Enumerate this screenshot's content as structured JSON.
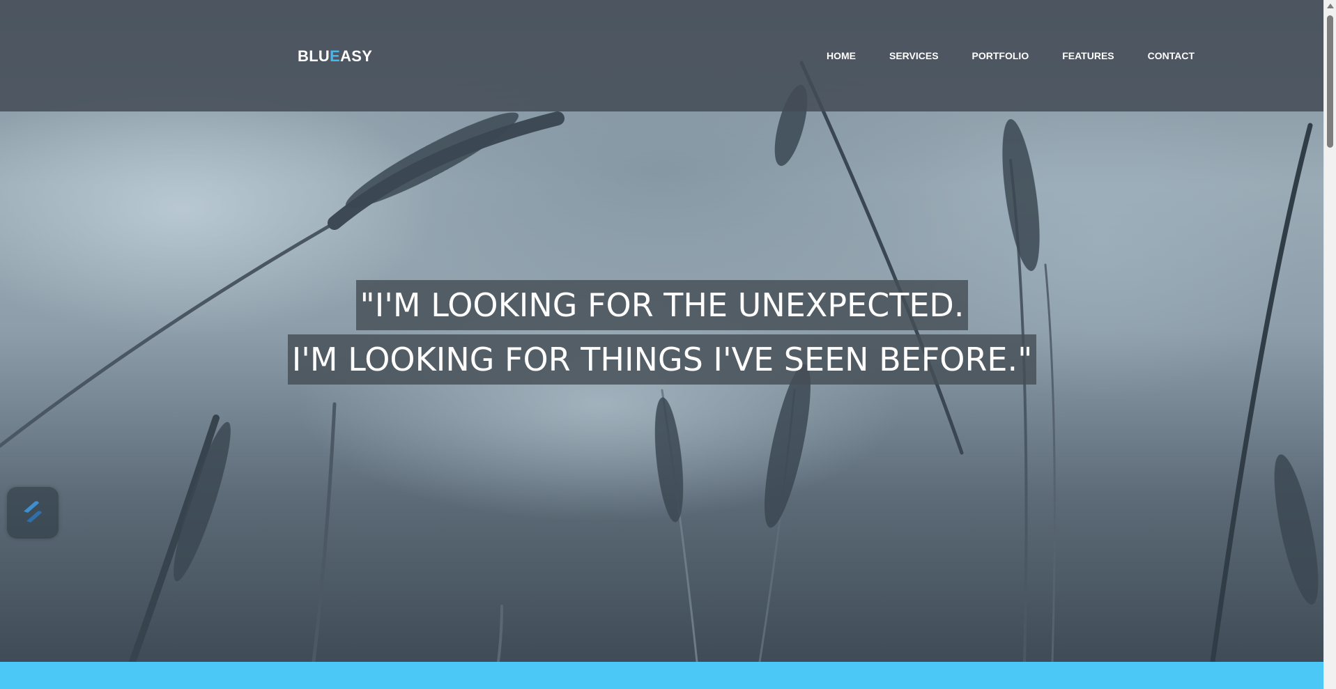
{
  "header": {
    "logo_part1": "BLU",
    "logo_part2": "E",
    "logo_part3": "ASY",
    "nav": [
      {
        "label": "HOME"
      },
      {
        "label": "SERVICES"
      },
      {
        "label": "PORTFOLIO"
      },
      {
        "label": "FEATURES"
      },
      {
        "label": "CONTACT"
      }
    ]
  },
  "hero": {
    "quote_line1": "\"I'M LOOKING FOR THE UNEXPECTED.",
    "quote_line2": "I'M LOOKING FOR THINGS I'VE SEEN BEFORE.\""
  },
  "widget": {
    "icon": "stacked-s-logo-icon"
  },
  "colors": {
    "accent": "#45b8ef",
    "header_bg": "#444c56",
    "band": "#4bc8f6"
  }
}
